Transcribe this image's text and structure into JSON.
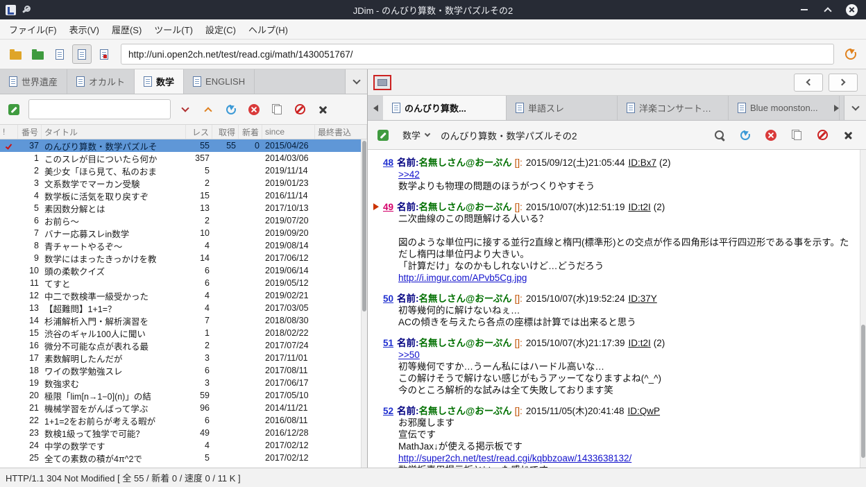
{
  "window": {
    "title": "JDim - のんびり算数・数学パズルその2"
  },
  "menubar": {
    "items": [
      "ファイル(F)",
      "表示(V)",
      "履歴(S)",
      "ツール(T)",
      "設定(C)",
      "ヘルプ(H)"
    ]
  },
  "toolbar": {
    "url": "http://uni.open2ch.net/test/read.cgi/math/1430051767/"
  },
  "board_pane": {
    "tabs": [
      {
        "label": "世界遺産",
        "active": false
      },
      {
        "label": "オカルト",
        "active": false
      },
      {
        "label": "数学",
        "active": true
      },
      {
        "label": "ENGLISH",
        "active": false
      }
    ],
    "search_value": "",
    "table": {
      "headers": [
        "!",
        "番号",
        "タイトル",
        "レス",
        "取得",
        "新着",
        "since",
        "最終書込"
      ],
      "rows": [
        {
          "mark": true,
          "num": "37",
          "title": "のんびり算数・数学パズルそ",
          "res": "55",
          "got": "55",
          "new": "0",
          "since": "2015/04/26",
          "last": "",
          "selected": true
        },
        {
          "mark": false,
          "num": "1",
          "title": "このスレが目についたら何か",
          "res": "357",
          "got": "",
          "new": "",
          "since": "2014/03/06",
          "last": "",
          "selected": false
        },
        {
          "mark": false,
          "num": "2",
          "title": "美少女「ほら見て、私のおま",
          "res": "5",
          "got": "",
          "new": "",
          "since": "2019/11/14",
          "last": "",
          "selected": false
        },
        {
          "mark": false,
          "num": "3",
          "title": "文系数学でマーカン受験",
          "res": "2",
          "got": "",
          "new": "",
          "since": "2019/01/23",
          "last": "",
          "selected": false
        },
        {
          "mark": false,
          "num": "4",
          "title": "数学板に活気を取り戻すぞ",
          "res": "15",
          "got": "",
          "new": "",
          "since": "2016/11/14",
          "last": "",
          "selected": false
        },
        {
          "mark": false,
          "num": "5",
          "title": "素因数分解とは",
          "res": "13",
          "got": "",
          "new": "",
          "since": "2017/10/13",
          "last": "",
          "selected": false
        },
        {
          "mark": false,
          "num": "6",
          "title": "お前ら〜",
          "res": "2",
          "got": "",
          "new": "",
          "since": "2019/07/20",
          "last": "",
          "selected": false
        },
        {
          "mark": false,
          "num": "7",
          "title": "バナー応募スレin数学",
          "res": "10",
          "got": "",
          "new": "",
          "since": "2019/09/20",
          "last": "",
          "selected": false
        },
        {
          "mark": false,
          "num": "8",
          "title": "青チャートやるぞ〜",
          "res": "4",
          "got": "",
          "new": "",
          "since": "2019/08/14",
          "last": "",
          "selected": false
        },
        {
          "mark": false,
          "num": "9",
          "title": "数学にはまったきっかけを教",
          "res": "14",
          "got": "",
          "new": "",
          "since": "2017/06/12",
          "last": "",
          "selected": false
        },
        {
          "mark": false,
          "num": "10",
          "title": "頭の柔軟クイズ",
          "res": "6",
          "got": "",
          "new": "",
          "since": "2019/06/14",
          "last": "",
          "selected": false
        },
        {
          "mark": false,
          "num": "11",
          "title": "てすと",
          "res": "6",
          "got": "",
          "new": "",
          "since": "2019/05/12",
          "last": "",
          "selected": false
        },
        {
          "mark": false,
          "num": "12",
          "title": "中二で数検準一級受かった",
          "res": "4",
          "got": "",
          "new": "",
          "since": "2019/02/21",
          "last": "",
          "selected": false
        },
        {
          "mark": false,
          "num": "13",
          "title": "【超難問】1+1=？",
          "res": "4",
          "got": "",
          "new": "",
          "since": "2017/03/05",
          "last": "",
          "selected": false
        },
        {
          "mark": false,
          "num": "14",
          "title": "杉浦解析入門・解析演習を",
          "res": "7",
          "got": "",
          "new": "",
          "since": "2018/08/30",
          "last": "",
          "selected": false
        },
        {
          "mark": false,
          "num": "15",
          "title": "渋谷のギャル100人に聞い",
          "res": "1",
          "got": "",
          "new": "",
          "since": "2018/02/22",
          "last": "",
          "selected": false
        },
        {
          "mark": false,
          "num": "16",
          "title": "微分不可能な点が表れる最",
          "res": "2",
          "got": "",
          "new": "",
          "since": "2017/07/24",
          "last": "",
          "selected": false
        },
        {
          "mark": false,
          "num": "17",
          "title": "素数解明したんだが",
          "res": "3",
          "got": "",
          "new": "",
          "since": "2017/11/01",
          "last": "",
          "selected": false
        },
        {
          "mark": false,
          "num": "18",
          "title": "ワイの数学勉強スレ",
          "res": "6",
          "got": "",
          "new": "",
          "since": "2017/08/11",
          "last": "",
          "selected": false
        },
        {
          "mark": false,
          "num": "19",
          "title": "数強求む",
          "res": "3",
          "got": "",
          "new": "",
          "since": "2017/06/17",
          "last": "",
          "selected": false
        },
        {
          "mark": false,
          "num": "20",
          "title": "極限「lim[n→1−0](n)」の結",
          "res": "59",
          "got": "",
          "new": "",
          "since": "2017/05/10",
          "last": "",
          "selected": false
        },
        {
          "mark": false,
          "num": "21",
          "title": "機械学習をがんばって学ぶ",
          "res": "96",
          "got": "",
          "new": "",
          "since": "2014/11/21",
          "last": "",
          "selected": false
        },
        {
          "mark": false,
          "num": "22",
          "title": "1+1=2をお前らが考える暇が",
          "res": "6",
          "got": "",
          "new": "",
          "since": "2016/08/11",
          "last": "",
          "selected": false
        },
        {
          "mark": false,
          "num": "23",
          "title": "数検1級って独学で可能？",
          "res": "49",
          "got": "",
          "new": "",
          "since": "2016/12/28",
          "last": "",
          "selected": false
        },
        {
          "mark": false,
          "num": "24",
          "title": "中学の数学です",
          "res": "4",
          "got": "",
          "new": "",
          "since": "2017/02/12",
          "last": "",
          "selected": false
        },
        {
          "mark": false,
          "num": "25",
          "title": "全ての素数の積が4π^2で",
          "res": "5",
          "got": "",
          "new": "",
          "since": "2017/02/12",
          "last": "",
          "selected": false
        }
      ]
    }
  },
  "thread_pane": {
    "tabs": [
      {
        "label": "のんびり算数...",
        "active": true
      },
      {
        "label": "単語スレ",
        "active": false
      },
      {
        "label": "洋楽コンサートスレ",
        "active": false
      },
      {
        "label": "Blue moonston...",
        "active": false
      }
    ],
    "board_select": "数学",
    "title": "のんびり算数・数学パズルその2",
    "posts": [
      {
        "num": "48",
        "marked": false,
        "num_style": "blue",
        "name_label": "名前:",
        "name": "名無しさん@おーぷん",
        "mail": "[]:",
        "date": "2015/09/12(土)21:05:44",
        "id": "ID:Bx7",
        "count": "(2)",
        "lines": [
          {
            "type": "link",
            "text": ">>42"
          },
          {
            "type": "text",
            "text": "数学よりも物理の問題のほうがつくりやすそう"
          }
        ]
      },
      {
        "num": "49",
        "marked": true,
        "num_style": "pink",
        "name_label": "名前:",
        "name": "名無しさん@おーぷん",
        "mail": "[]:",
        "date": "2015/10/07(水)12:51:19",
        "id": "ID:t2I",
        "count": "(2)",
        "lines": [
          {
            "type": "text",
            "text": "二次曲線のこの問題解ける人いる？"
          },
          {
            "type": "text",
            "text": ""
          },
          {
            "type": "text",
            "text": "図のような単位円に接する並行2直線と楕円(標準形)との交点が作る四角形は平行四辺形である事を示す。ただし楕円は単位円より大きい。"
          },
          {
            "type": "text",
            "text": "「計算だけ」なのかもしれないけど…どうだろう"
          },
          {
            "type": "link",
            "text": "http://i.imgur.com/APvb5Cg.jpg"
          }
        ]
      },
      {
        "num": "50",
        "marked": false,
        "num_style": "blue",
        "name_label": "名前:",
        "name": "名無しさん@おーぷん",
        "mail": "[]:",
        "date": "2015/10/07(水)19:52:24",
        "id": "ID:37Y",
        "count": "",
        "lines": [
          {
            "type": "text",
            "text": "初等幾何的に解けないねぇ…"
          },
          {
            "type": "text",
            "text": "ACの傾きを与えたら各点の座標は計算では出来ると思う"
          }
        ]
      },
      {
        "num": "51",
        "marked": false,
        "num_style": "blue",
        "name_label": "名前:",
        "name": "名無しさん@おーぷん",
        "mail": "[]:",
        "date": "2015/10/07(水)21:17:39",
        "id": "ID:t2I",
        "count": "(2)",
        "lines": [
          {
            "type": "link",
            "text": ">>50"
          },
          {
            "type": "text",
            "text": "初等幾何ですか…うーん私にはハードル高いな…"
          },
          {
            "type": "text",
            "text": "この解けそうで解けない感じがもうアッーてなりますよね(^_^)"
          },
          {
            "type": "text",
            "text": "今のところ解析的な試みは全て失敗しております笑"
          }
        ]
      },
      {
        "num": "52",
        "marked": false,
        "num_style": "blue",
        "name_label": "名前:",
        "name": "名無しさん@おーぷん",
        "mail": "[]:",
        "date": "2015/11/05(木)20:41:48",
        "id": "ID:QwP",
        "count": "",
        "lines": [
          {
            "type": "text",
            "text": "お邪魔します"
          },
          {
            "type": "text",
            "text": "宣伝です"
          },
          {
            "type": "text",
            "text": "MathJax↓が使える掲示板です"
          },
          {
            "type": "link",
            "text": "http://super2ch.net/test/read.cgi/kqbbzoaw/1433638132/"
          },
          {
            "type": "text",
            "text": "数学板専用掲示板といった感じです"
          }
        ]
      }
    ]
  },
  "statusbar": {
    "text": "HTTP/1.1 304 Not Modified [ 全 55 / 新着 0 / 速度 0 / 11 K ]"
  }
}
